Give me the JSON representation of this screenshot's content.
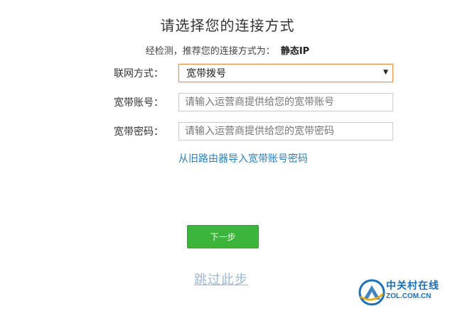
{
  "page": {
    "title": "请选择您的连接方式",
    "detect_prefix": "经检测，推荐您的连接方式为：",
    "detect_value": "静态IP"
  },
  "form": {
    "connection_type": {
      "label": "联网方式：",
      "selected": "宽带拨号",
      "arrow_icon": "triangle-down-icon"
    },
    "account": {
      "label": "宽带账号：",
      "value": "",
      "placeholder": "请输入运营商提供给您的宽带账号"
    },
    "password": {
      "label": "宽带密码：",
      "value": "",
      "placeholder": "请输入运营商提供给您的宽带密码"
    },
    "import_link": "从旧路由器导入宽带账号密码"
  },
  "actions": {
    "next": "下一步",
    "skip": "跳过此步"
  },
  "watermark": {
    "name": "中关村在线",
    "domain": "ZOL.COM.CN"
  },
  "colors": {
    "primary_button": "#3cb53c",
    "link": "#2e7dbd",
    "skip_link": "#9ab8d6",
    "select_focus_border": "#e8914a",
    "watermark": "#1d6fb8"
  }
}
